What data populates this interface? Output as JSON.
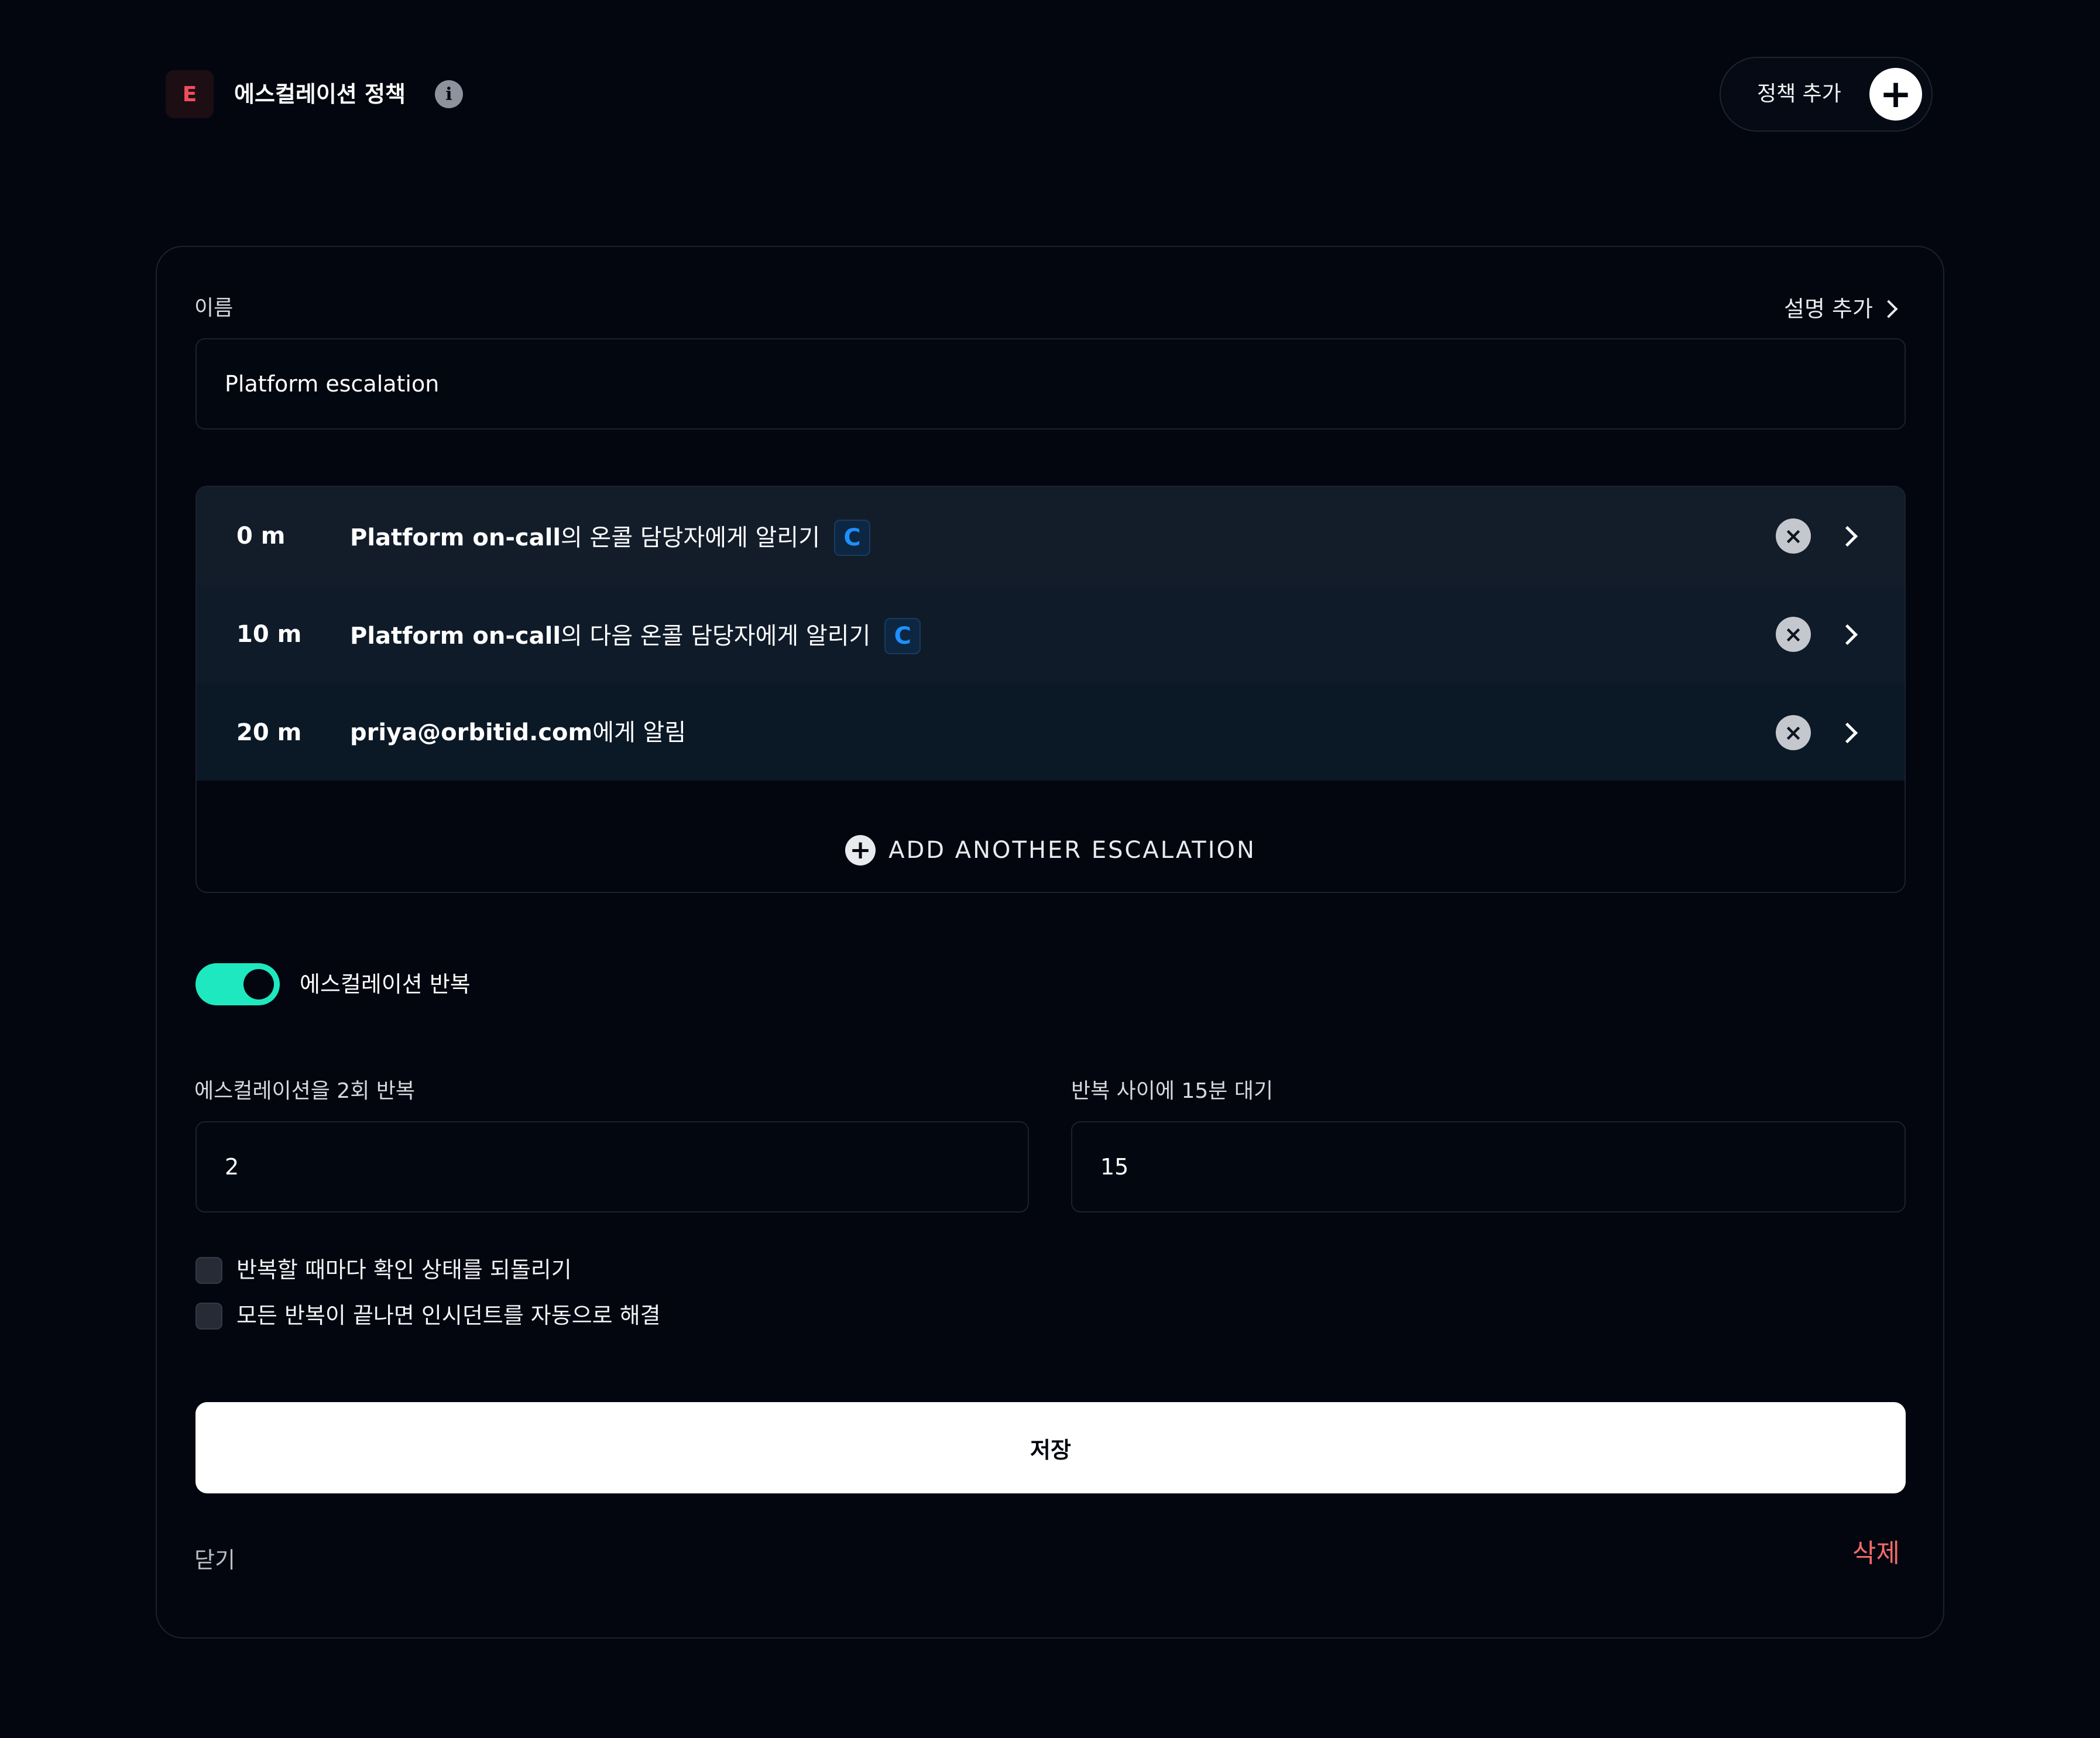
{
  "header": {
    "logo_letter": "E",
    "title": "에스컬레이션 정책",
    "info_symbol": "i",
    "add_policy_label": "정책 추가",
    "add_policy_symbol": "+"
  },
  "form": {
    "name_label": "이름",
    "add_description_label": "설명 추가",
    "name_value": "Platform escalation",
    "escalations": [
      {
        "delay": "0 m",
        "strong": "Platform on-call",
        "rest": "의 온콜 담당자에게 알리기",
        "badge": "C"
      },
      {
        "delay": "10 m",
        "strong": "Platform on-call",
        "rest": "의 다음 온콜 담당자에게 알리기",
        "badge": "C"
      },
      {
        "delay": "20 m",
        "strong": "priya@orbitid.com",
        "rest": "에게 알림",
        "badge": ""
      }
    ],
    "remove_symbol": "×",
    "add_escalation_label": "ADD ANOTHER ESCALATION",
    "add_escalation_symbol": "+",
    "repeat_toggle_label": "에스컬레이션 반복",
    "repeat_toggle_on": true,
    "repeat_count_label": "에스컬레이션을 2회 반복",
    "repeat_count_value": "2",
    "repeat_wait_label": "반복 사이에 15분 대기",
    "repeat_wait_value": "15",
    "reset_ack_label": "반복할 때마다 확인 상태를 되돌리기",
    "auto_resolve_label": "모든 반복이 끝나면 인시던트를 자동으로 해결",
    "save_label": "저장",
    "close_label": "닫기",
    "delete_label": "삭제"
  },
  "colors": {
    "background": "#03060f",
    "accent_toggle": "#1ee8bf",
    "badge_blue": "#1e8fff",
    "danger": "#f26a6a",
    "logo_red": "#ef4d5c"
  }
}
